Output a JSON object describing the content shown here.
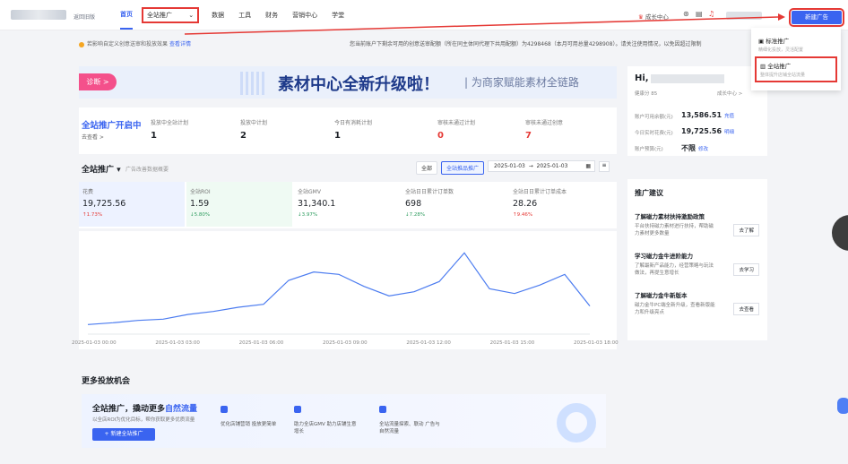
{
  "topbar": {
    "version": "返回旧版",
    "nav": [
      "首页",
      "全站推广",
      "数据",
      "工具",
      "财务",
      "营销中心",
      "学堂"
    ],
    "growth": "成长中心",
    "new_ad": "新建广告"
  },
  "notice": {
    "text": "若影响自定义创意送审和投放效果",
    "link": "查看详情",
    "right": "您当前账户下剩余可用的创意送审配额（所在同主体同代理下共用配额）为4298468（本月可用总量4298908）。请关注使用情况，以免因超过限制"
  },
  "banner": {
    "btn": "诊断 >",
    "title": "素材中心全新升级啦！",
    "sub": "| 为商家赋能素材全链路"
  },
  "stats": {
    "title": "全站推广开启中",
    "sub": "去查看 >",
    "items": [
      {
        "l": "投放中全站计划",
        "v": "1"
      },
      {
        "l": "投放中计划",
        "v": "2"
      },
      {
        "l": "今日有消耗计划",
        "v": "1"
      },
      {
        "l": "审核未通过计划",
        "v": "0"
      },
      {
        "l": "审核未通过创意",
        "v": "7"
      }
    ]
  },
  "section": {
    "title": "全站推广 ▾",
    "sub": "广告改善数据概要",
    "filters": [
      "全部",
      "全站推品推广"
    ],
    "date_from": "2025-01-03",
    "date_to": "2025-01-03"
  },
  "metrics": [
    {
      "l": "花费",
      "v": "19,725.56",
      "d": "↑1.73%"
    },
    {
      "l": "全站ROI",
      "v": "1.59",
      "d": "↓5.80%"
    },
    {
      "l": "全站GMV",
      "v": "31,340.1",
      "d": "↓3.97%"
    },
    {
      "l": "全站日日累计订单数",
      "v": "698",
      "d": "↓7.28%"
    },
    {
      "l": "全站日日累计订单成本",
      "v": "28.26",
      "d": "↑9.46%"
    }
  ],
  "chart_data": {
    "type": "line",
    "x": [
      "2025-01-03 00:00",
      "2025-01-03 03:00",
      "2025-01-03 06:00",
      "2025-01-03 09:00",
      "2025-01-03 12:00",
      "2025-01-03 15:00",
      "2025-01-03 18:00"
    ],
    "series": [
      {
        "values": [
          160,
          190,
          230,
          250,
          330,
          380,
          450,
          500,
          900,
          1040,
          1000,
          800,
          640,
          710,
          880,
          1360,
          760,
          680,
          820,
          1000,
          470
        ]
      }
    ],
    "color": "#4c7cf0"
  },
  "more": {
    "title": "更多投放机会",
    "promo_title": "全站推广，撬动更多",
    "promo_hl": "自然流量",
    "promo_sub": "以全店ROI为优化目标，帮你获取更多优质流量",
    "promo_btn": "+ 新建全站推广",
    "f1": "优化店铺营销 投放更简单",
    "f2": "助力全店GMV 助力店铺生意增长",
    "f3": "全站流量探索、联动 广告与自然流量"
  },
  "side": {
    "hi": "Hi,",
    "level": "健康分 85",
    "center": "成长中心 >",
    "rows": [
      {
        "l": "账户可用余额(元)",
        "v": "13,586.51",
        "k": "充值"
      },
      {
        "l": "今日实时花费(元)",
        "v": "19,725.56",
        "k": "明细"
      },
      {
        "l": "账户预算(元)",
        "v": "不限",
        "k": "修改"
      }
    ],
    "tips_title": "推广建议",
    "tips": [
      {
        "t": "了解磁力素材扶持激励政策",
        "s": "平台扶持磁力素材进行扶持，帮助磁力素材更多数量",
        "b": "去了解"
      },
      {
        "t": "学习磁力金牛进阶能力",
        "s": "了解最新产品能力，经营策略与玩法做法，再提生意增长",
        "b": "去学习"
      },
      {
        "t": "了解磁力金牛新版本",
        "s": "磁力金牛PC端全新升级，查看新版能力和升级亮点",
        "b": "去查看"
      }
    ]
  },
  "dropdown": [
    {
      "a": "标准推广",
      "b": "精细化投放，灵活配置"
    },
    {
      "a": "全站推广",
      "b": "整体提升店铺全站流量"
    }
  ]
}
